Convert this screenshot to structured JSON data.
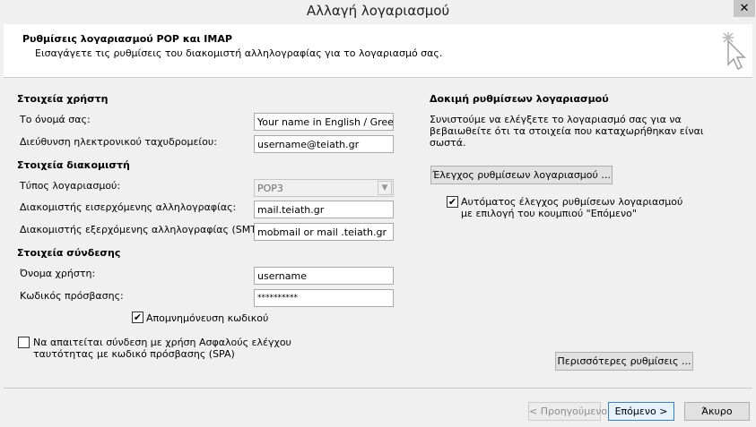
{
  "window": {
    "title": "Αλλαγή λογαριασμού",
    "close_glyph": "✕"
  },
  "header": {
    "title": "Ρυθμίσεις λογαριασμού POP και IMAP",
    "subtitle": "Εισαγάγετε τις ρυθμίσεις του διακομιστή αλληλογραφίας για το λογαριασμό σας."
  },
  "user_info": {
    "heading": "Στοιχεία χρήστη",
    "name_label": "Το όνομά σας:",
    "name_value": "Your name in English / Greek",
    "email_label": "Διεύθυνση ηλεκτρονικού ταχυδρομείου:",
    "email_value": "username@teiath.gr"
  },
  "server_info": {
    "heading": "Στοιχεία διακομιστή",
    "account_type_label": "Τύπος λογαριασμού:",
    "account_type_value": "POP3",
    "incoming_label": "Διακομιστής εισερχόμενης αλληλογραφίας:",
    "incoming_value": "mail.teiath.gr",
    "outgoing_label": "Διακομιστής εξερχόμενης αλληλογραφίας (SMTP):",
    "outgoing_value": "mobmail or mail  .teiath.gr"
  },
  "login_info": {
    "heading": "Στοιχεία σύνδεσης",
    "username_label": "Όνομα χρήστη:",
    "username_value": "username",
    "password_label": "Κωδικός πρόσβασης:",
    "password_value": "**********",
    "remember_label": "Απομνημόνευση κωδικού",
    "remember_checked": true,
    "spa_label_line1": "Να απαιτείται σύνδεση με χρήση Ασφαλούς ελέγχου",
    "spa_label_line2": "ταυτότητας με κωδικό πρόσβασης (SPA)",
    "spa_checked": false
  },
  "test_settings": {
    "heading": "Δοκιμή ρυθμίσεων λογαριασμού",
    "desc_line1": "Συνιστούμε να ελέγξετε το λογαριασμό σας για να",
    "desc_line2": "βεβαιωθείτε ότι τα στοιχεία που καταχωρήθηκαν είναι",
    "desc_line3": "σωστά.",
    "test_button": "Έλεγχος ρυθμίσεων λογαριασμού ...",
    "auto_label_line1": "Αυτόματος έλεγχος ρυθμίσεων λογαριασμού",
    "auto_label_line2": "με επιλογή του κουμπιού \"Επόμενο\"",
    "auto_checked": true,
    "more_settings_button": "Περισσότερες ρυθμίσεις ..."
  },
  "footer": {
    "back_button": "< Προηγούμενο",
    "next_button": "Επόμενο >",
    "cancel_button": "Άκυρο"
  },
  "check_glyph": "✔"
}
